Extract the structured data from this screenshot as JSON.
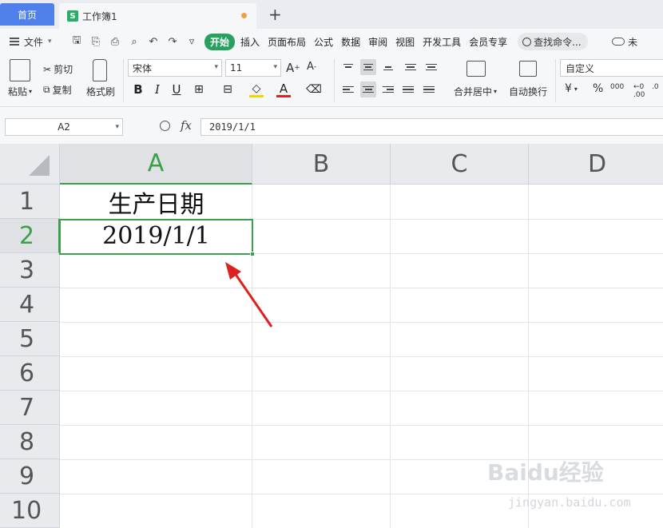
{
  "tabs": {
    "home": "首页",
    "doc_icon": "S",
    "doc_title": "工作簿1",
    "new_tab": "+"
  },
  "menu": {
    "file": "文件",
    "items": [
      "开始",
      "插入",
      "页面布局",
      "公式",
      "数据",
      "审阅",
      "视图",
      "开发工具",
      "会员专享"
    ],
    "active_index": 0,
    "search_placeholder": "查找命令...",
    "cloud_label": "未"
  },
  "ribbon": {
    "paste": "粘贴",
    "cut": "剪切",
    "copy": "复制",
    "format_painter": "格式刷",
    "font_name": "宋体",
    "font_size": "11",
    "bold": "B",
    "italic": "I",
    "underline": "U",
    "font_color_glyph": "A",
    "merge_center": "合并居中",
    "wrap_text": "自动换行",
    "number_format": "自定义",
    "currency": "¥",
    "percent": "%",
    "thousands": "000"
  },
  "formula_bar": {
    "name_box": "A2",
    "fx": "fx",
    "content": "2019/1/1"
  },
  "sheet": {
    "columns": [
      "A",
      "B",
      "C",
      "D"
    ],
    "rows": [
      "1",
      "2",
      "3",
      "4",
      "5",
      "6",
      "7",
      "8",
      "9",
      "10"
    ],
    "selected_column": "A",
    "selected_row": "2",
    "cells": {
      "A1": "生产日期",
      "A2": "2019/1/1"
    }
  },
  "colors": {
    "accent_green": "#3aa04a",
    "home_tab_blue": "#4f7fe8",
    "arrow_red": "#e02020"
  },
  "watermark": {
    "main": "Baidu经验",
    "sub": "jingyan.baidu.com"
  }
}
